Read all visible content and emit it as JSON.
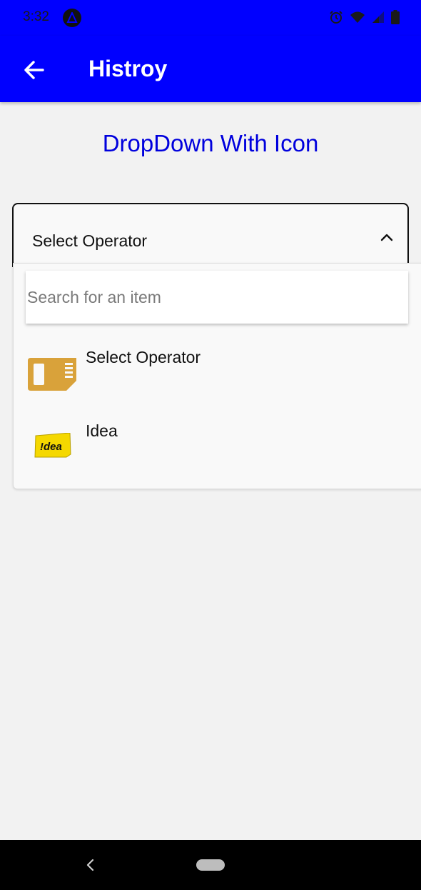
{
  "status_bar": {
    "time": "3:32",
    "icons": [
      "app-notification-icon",
      "alarm-icon",
      "wifi-icon",
      "signal-icon",
      "battery-icon"
    ]
  },
  "app_bar": {
    "title": "Histroy",
    "back_icon": "arrow-left-icon",
    "background": "#0000ff"
  },
  "heading": "DropDown With Icon",
  "dropdown": {
    "selected_label": "Select Operator",
    "expanded": true,
    "search_placeholder": "Search for an item",
    "search_value": "",
    "items": [
      {
        "label": "Select Operator",
        "icon": "sim-card-icon"
      },
      {
        "label": "Idea",
        "icon": "idea-logo-icon"
      }
    ]
  },
  "colors": {
    "accent": "#0000ff",
    "heading_text": "#0000dd",
    "sim_icon": "#d9a23a",
    "idea_logo": "#f5d800"
  },
  "nav_bar": {
    "back_icon": "nav-back-icon",
    "home_icon": "home-pill-icon"
  }
}
